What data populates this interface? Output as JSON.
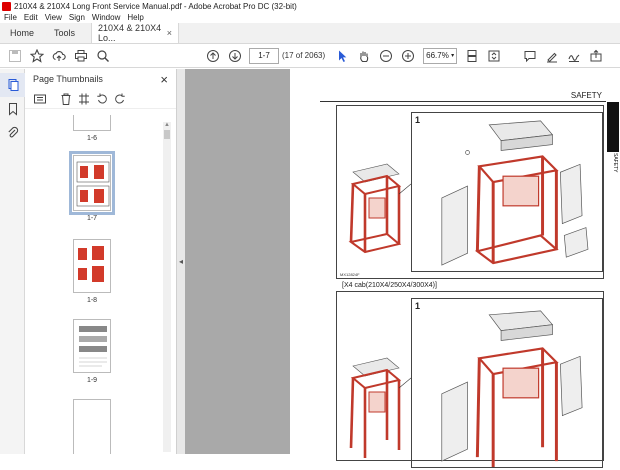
{
  "window": {
    "title": "210X4 & 210X4 Long Front Service Manual.pdf - Adobe Acrobat Pro DC (32-bit)"
  },
  "menu": [
    "File",
    "Edit",
    "View",
    "Sign",
    "Window",
    "Help"
  ],
  "tabs": {
    "home": "Home",
    "tools": "Tools",
    "document": "210X4 & 210X4 Lo...",
    "close": "×"
  },
  "toolbar": {
    "page_current": "1-7",
    "page_count": "(17 of 2063)",
    "zoom": "66.7%"
  },
  "thumbnails": {
    "title": "Page Thumbnails",
    "close": "×",
    "items": [
      {
        "label": "1-6"
      },
      {
        "label": "1-7"
      },
      {
        "label": "1-8"
      },
      {
        "label": "1-9"
      }
    ]
  },
  "document": {
    "header": "SAFETY",
    "side_label": "SAFETY",
    "figure1_num": "1",
    "figure1_code": "MX12824F",
    "caption": "[X4 cab(210X4/250X4/300X4)]",
    "figure2_num": "1"
  },
  "colors": {
    "accent_red": "#d23a2a",
    "canvas_gray": "#a9a9a9",
    "selected_thumb": "#9fb8d8"
  }
}
